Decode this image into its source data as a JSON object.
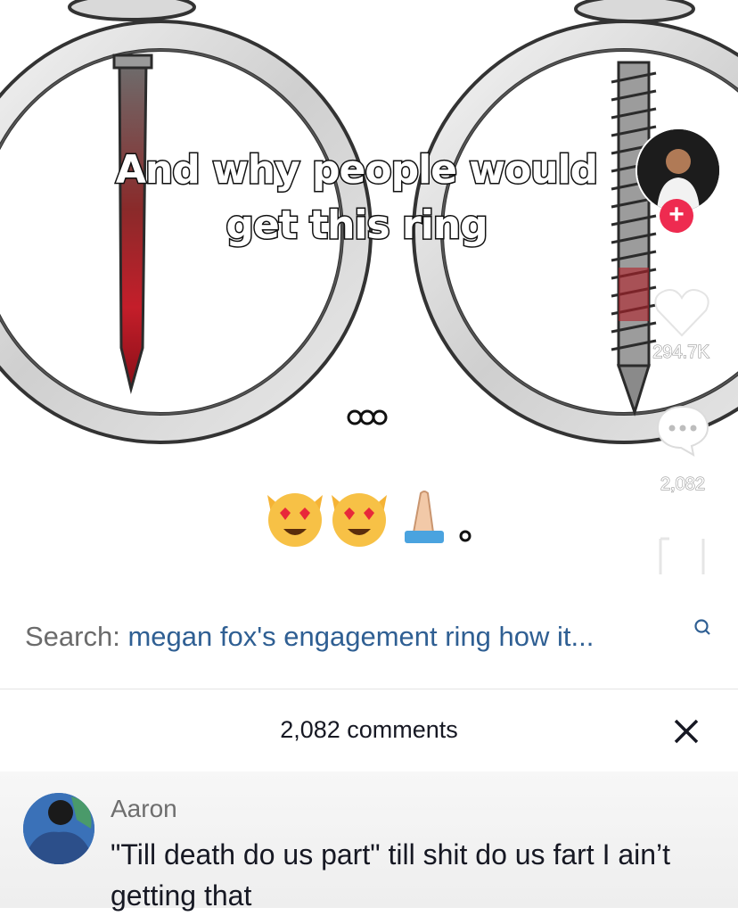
{
  "video": {
    "caption_line1": "And why people would",
    "caption_line2": "get this ring",
    "like_count": "294.7K",
    "comment_count": "2,082"
  },
  "search": {
    "prefix": "Search:",
    "query": "megan fox's engagement ring how it..."
  },
  "comments_panel": {
    "header": "2,082 comments",
    "comments": [
      {
        "user": "Aaron",
        "text": "\"Till death do us part\" till shit do us fart I ain’t getting that"
      }
    ]
  },
  "colors": {
    "follow_button": "#ee2b50",
    "search_query": "#2f5f93",
    "blood_red": "#c41e2a"
  },
  "icons": [
    "heart-icon",
    "comment-icon",
    "share-icon",
    "search-icon",
    "close-icon",
    "plus-icon"
  ]
}
